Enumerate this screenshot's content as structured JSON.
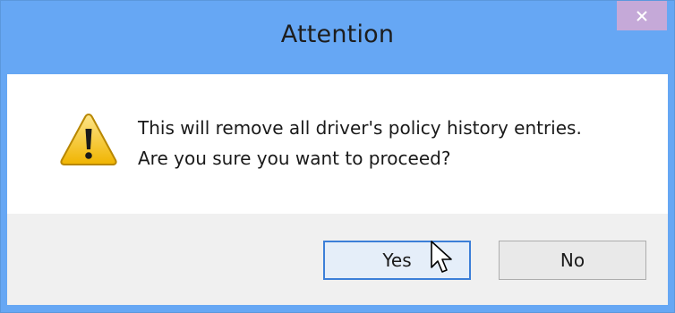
{
  "dialog": {
    "title": "Attention",
    "close_icon": "close-icon",
    "message_lines": [
      "This will remove all driver's policy history entries.",
      "Are you sure you want to proceed?"
    ],
    "icon": "warning-icon",
    "buttons": {
      "yes_label": "Yes",
      "no_label": "No"
    }
  },
  "colors": {
    "titlebar": "#66a7f4",
    "close_hover": "#c5a9d8",
    "footer": "#f0f0f0"
  }
}
